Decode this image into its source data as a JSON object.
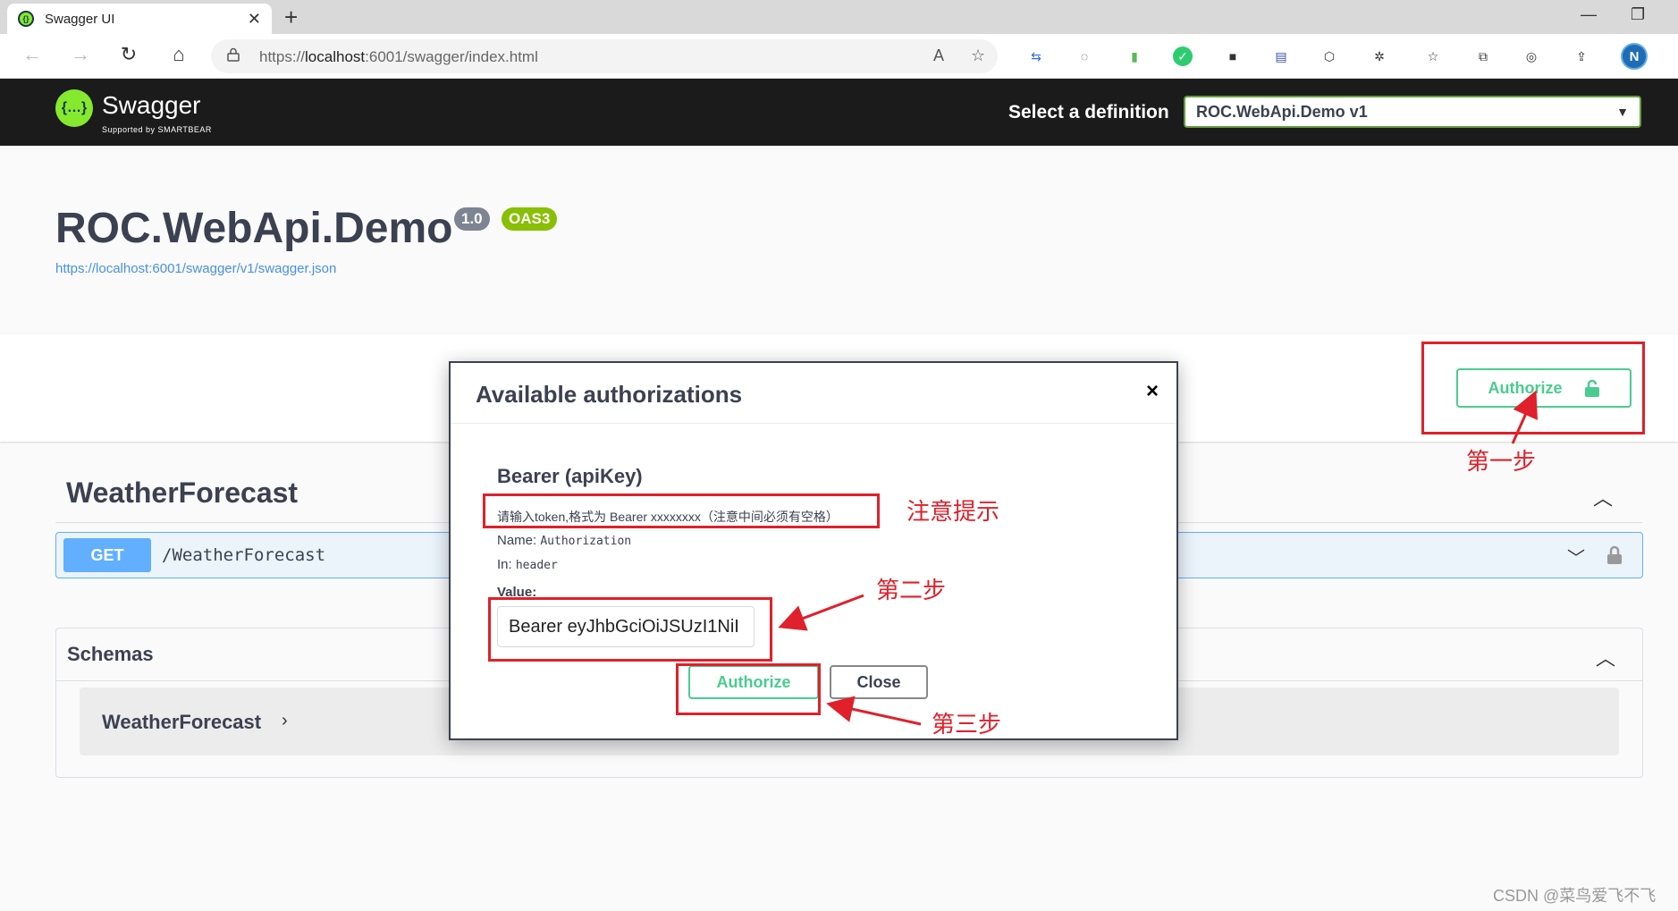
{
  "browser": {
    "tab_title": "Swagger UI",
    "tab_close": "✕",
    "new_tab": "+",
    "url_prefix": "https://",
    "url_host": "localhost",
    "url_rest": ":6001/swagger/index.html",
    "profile_initial": "N",
    "minimize": "—",
    "restore": "❐"
  },
  "topbar": {
    "logo_text": "Swagger",
    "logo_sub": "Supported by SMARTBEAR",
    "definition_label": "Select a definition",
    "definition_value": "ROC.WebApi.Demo v1"
  },
  "info": {
    "title": "ROC.WebApi.Demo",
    "version": "1.0",
    "oas": "OAS3",
    "spec_url": "https://localhost:6001/swagger/v1/swagger.json"
  },
  "scheme": {
    "authorize_label": "Authorize"
  },
  "tag": {
    "name": "WeatherForecast",
    "operation": {
      "method": "GET",
      "path": "/WeatherForecast"
    }
  },
  "schemas": {
    "title": "Schemas",
    "models": [
      "WeatherForecast"
    ]
  },
  "modal": {
    "title": "Available authorizations",
    "close_x": "×",
    "scheme_title": "Bearer  (apiKey)",
    "description": "请输入token,格式为 Bearer xxxxxxxx（注意中间必须有空格）",
    "name_label": "Name:",
    "name_value": "Authorization",
    "in_label": "In:",
    "in_value": "header",
    "value_label": "Value:",
    "value_input": "Bearer eyJhbGciOiJSUzI1NiI",
    "authorize_label": "Authorize",
    "close_label": "Close"
  },
  "annotations": {
    "step1": "第一步",
    "note": "注意提示",
    "step2": "第二步",
    "step3": "第三步"
  },
  "watermark": "CSDN @菜鸟爱飞不飞",
  "colors": {
    "annotation_red": "#e0202a",
    "swagger_green": "#49cc90",
    "get_blue": "#61affe"
  }
}
